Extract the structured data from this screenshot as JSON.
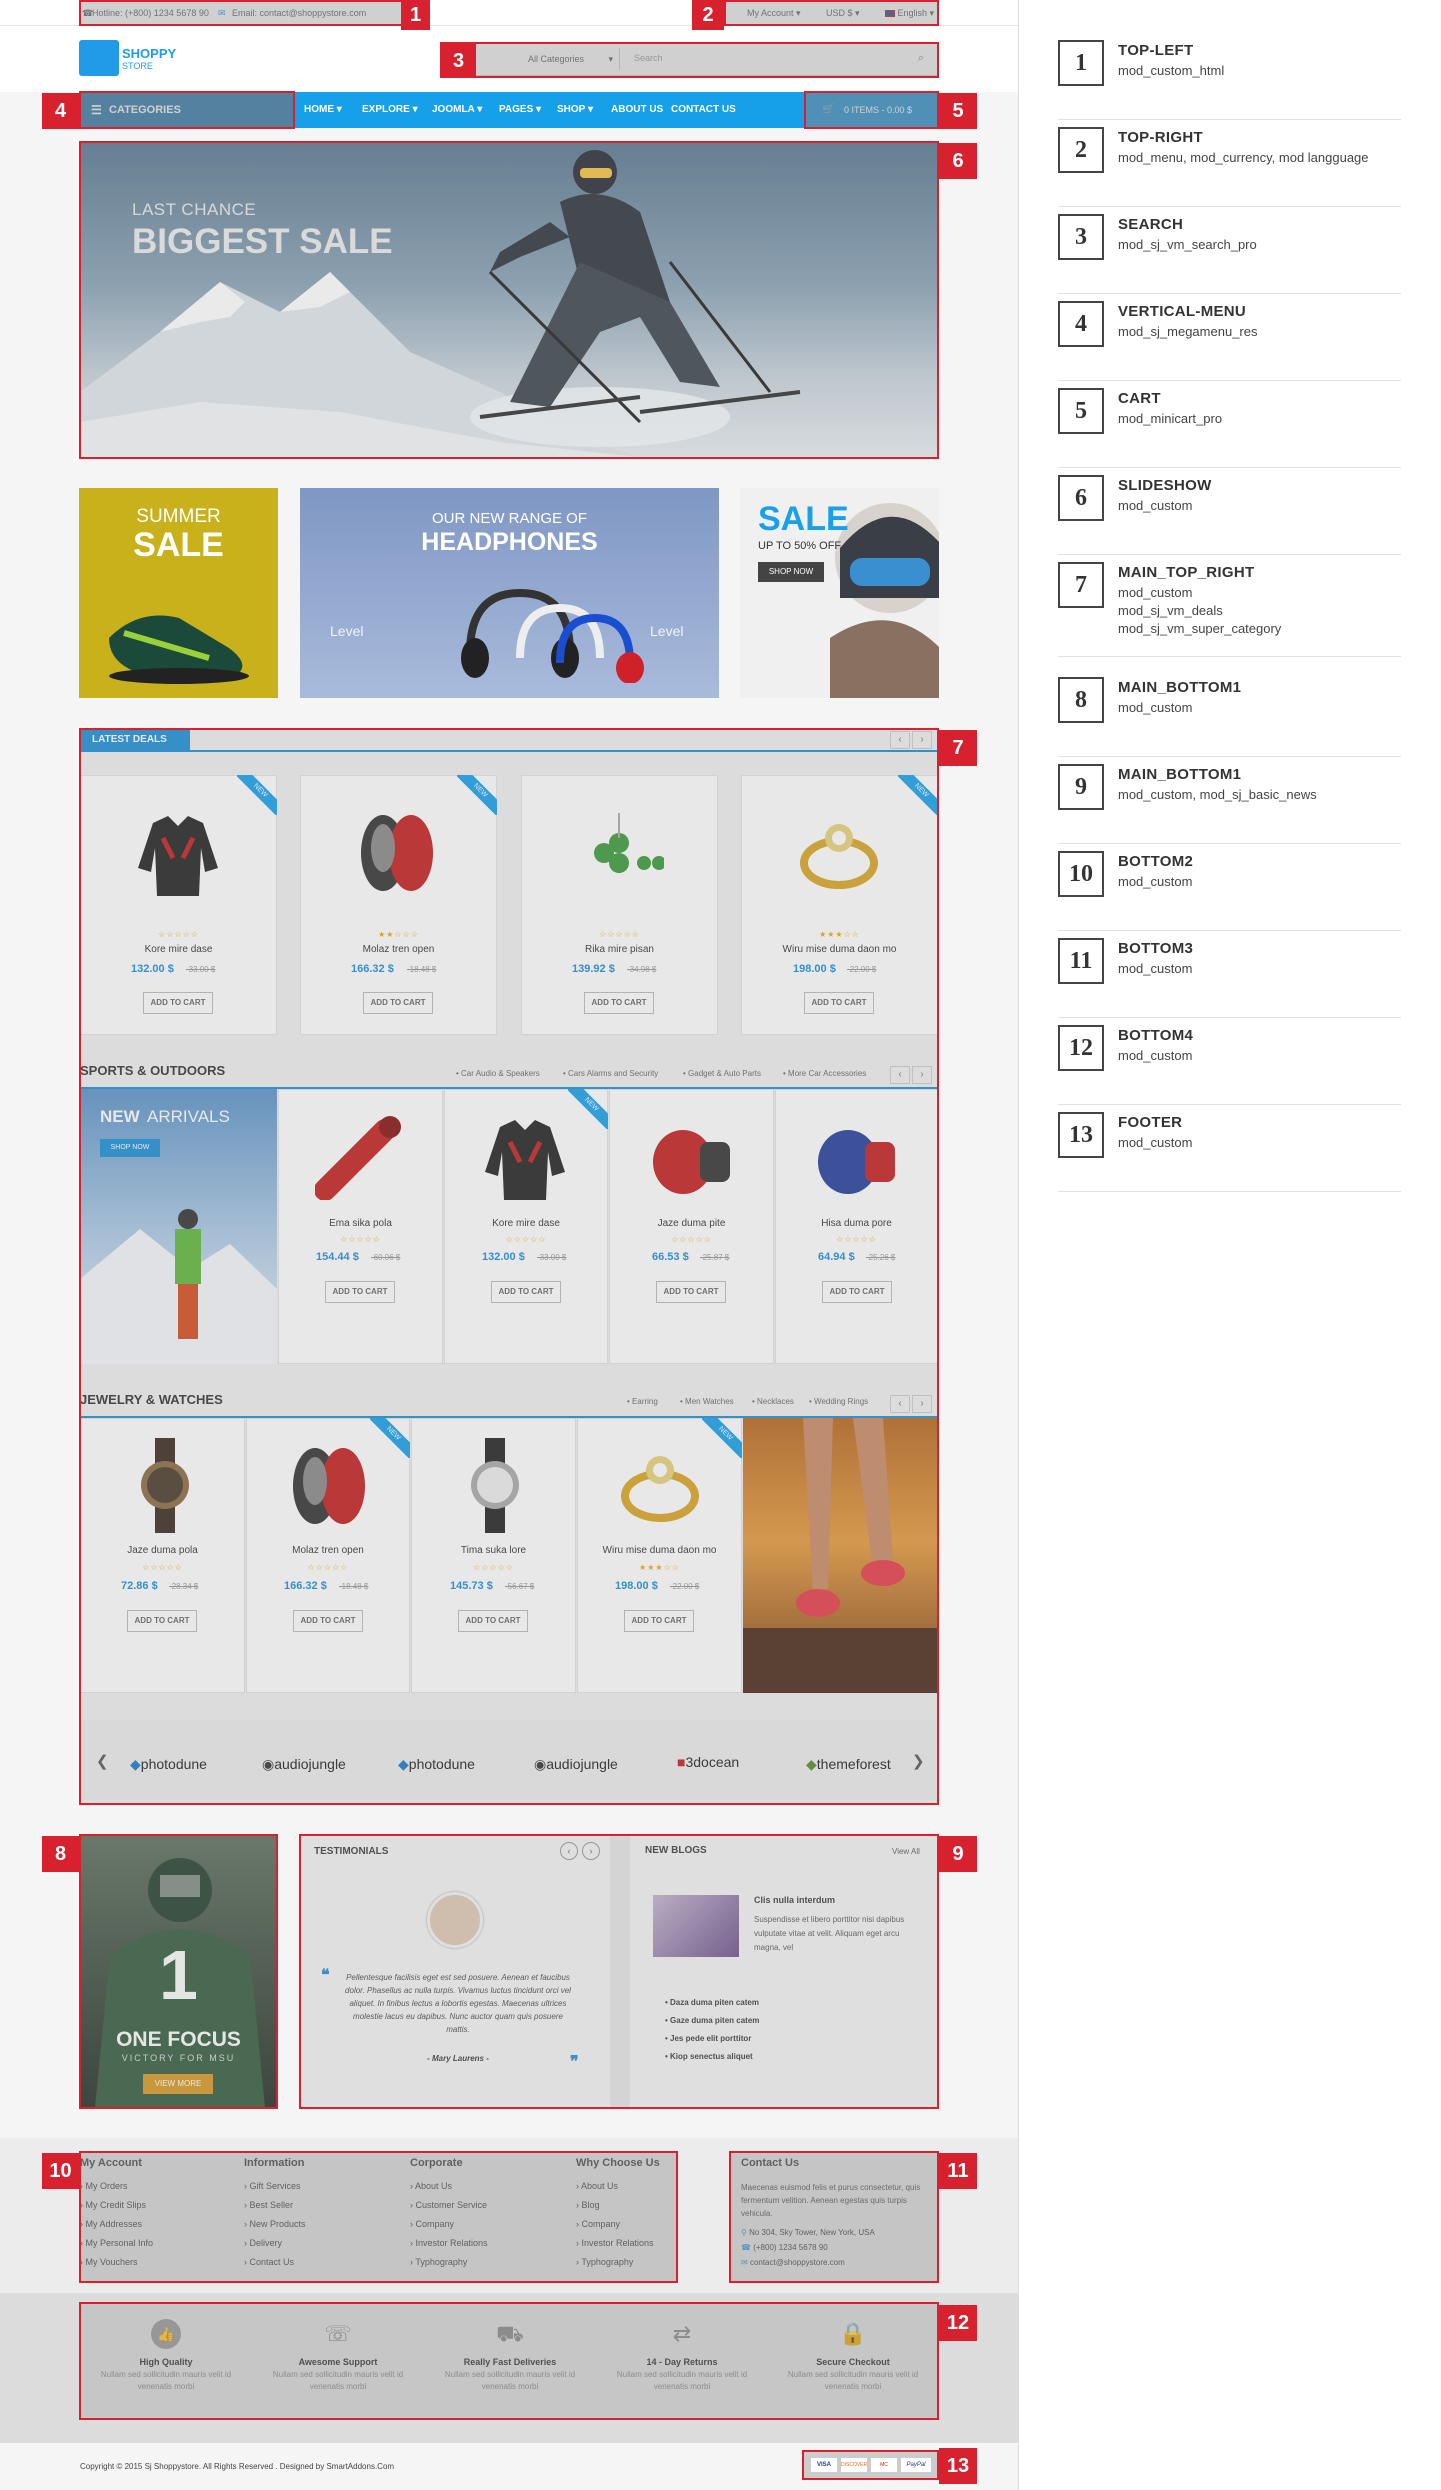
{
  "topbar": {
    "hotline": "Hotline: (+800) 1234 5678 90",
    "email": "Email: contact@shoppystore.com",
    "account": "My Account",
    "currency": "USD $",
    "language": "English"
  },
  "header": {
    "logo_line1": "SHOPPY",
    "logo_line2": "STORE",
    "search_category": "All Categories",
    "search_placeholder": "Search"
  },
  "nav": {
    "categories_label": "CATEGORIES",
    "items": [
      "HOME",
      "EXPLORE",
      "JOOMLA",
      "PAGES",
      "SHOP",
      "ABOUT US",
      "CONTACT US"
    ],
    "cart_label": "0 ITEMS - 0.00 $"
  },
  "slideshow": {
    "kicker": "LAST CHANCE",
    "headline": "BIGGEST SALE"
  },
  "banners": {
    "summer_1": "SUMMER",
    "summer_2": "SALE",
    "headphones_1": "OUR NEW RANGE OF",
    "headphones_2": "HEADPHONES",
    "headphones_brand": "Level",
    "sale_1": "SALE",
    "sale_2": "UP TO 50% OFF",
    "sale_btn": "SHOP NOW"
  },
  "latest_deals": {
    "title": "LATEST DEALS",
    "badge": "NEW",
    "button": "ADD TO CART",
    "products": [
      {
        "name": "Kore mire dase",
        "price": "132.00 $",
        "old": "-33.00 $",
        "stars": "☆☆☆☆☆"
      },
      {
        "name": "Molaz tren open",
        "price": "166.32 $",
        "old": "-18.48 $",
        "stars": "★★☆☆☆"
      },
      {
        "name": "Rika mire pisan",
        "price": "139.92 $",
        "old": "-34.98 $",
        "stars": "☆☆☆☆☆"
      },
      {
        "name": "Wiru mise duma daon mo",
        "price": "198.00 $",
        "old": "-22.00 $",
        "stars": "★★★☆☆"
      }
    ]
  },
  "sports": {
    "title": "SPORTS & OUTDOORS",
    "tabs": [
      "Car Audio & Speakers",
      "Cars Alarms and Security",
      "Gadget & Auto Parts",
      "More Car Accessories"
    ],
    "promo_1": "NEW",
    "promo_2": "ARRIVALS",
    "promo_btn": "SHOP NOW",
    "badge": "NEW",
    "button": "ADD TO CART",
    "products": [
      {
        "name": "Ema sika pola",
        "price": "154.44 $",
        "old": "-60.06 $",
        "stars": "☆☆☆☆☆"
      },
      {
        "name": "Kore mire dase",
        "price": "132.00 $",
        "old": "-33.00 $",
        "stars": "☆☆☆☆☆"
      },
      {
        "name": "Jaze duma pite",
        "price": "66.53 $",
        "old": "-25.87 $",
        "stars": "☆☆☆☆☆"
      },
      {
        "name": "Hisa duma pore",
        "price": "64.94 $",
        "old": "-25.26 $",
        "stars": "☆☆☆☆☆"
      }
    ]
  },
  "jewelry": {
    "title": "JEWELRY & WATCHES",
    "tabs": [
      "Earring",
      "Men Watches",
      "Necklaces",
      "Wedding Rings"
    ],
    "badge": "NEW",
    "button": "ADD TO CART",
    "products": [
      {
        "name": "Jaze duma pola",
        "price": "72.86 $",
        "old": "-28.34 $",
        "stars": "☆☆☆☆☆"
      },
      {
        "name": "Molaz tren open",
        "price": "166.32 $",
        "old": "-18.48 $",
        "stars": "☆☆☆☆☆"
      },
      {
        "name": "Tima suka lore",
        "price": "145.73 $",
        "old": "-56.67 $",
        "stars": "☆☆☆☆☆"
      },
      {
        "name": "Wiru mise duma daon mo",
        "price": "198.00 $",
        "old": "-22.00 $",
        "stars": "★★★☆☆"
      }
    ]
  },
  "brands": [
    "photodune",
    "audiojungle",
    "photodune",
    "audiojungle",
    "3docean",
    "themeforest"
  ],
  "msu": {
    "line1": "ONE FOCUS",
    "line2": "VICTORY FOR MSU",
    "button": "VIEW MORE",
    "jersey": "1"
  },
  "testimonials": {
    "title": "TESTIMONIALS",
    "quote": "Pellentesque facilisis eget est sed posuere. Aenean et faucibus dolor. Phasellus ac nulla turpis. Vivamus luctus tincidunt orci vel aliquet. In finibus lectus a lobortis egestas. Maecenas ultrices molestie lacus eu dapibus. Nunc auctor quam quis posuere mattis.",
    "author": "- Mary Laurens -"
  },
  "blogs": {
    "title": "NEW BLOGS",
    "view_all": "View All",
    "post_title": "Clis nulla interdum",
    "post_text": "Suspendisse et libero porttitor nisi dapibus vulputate vitae at velit. Aliquam eget arcu magna, vel",
    "list": [
      "Daza duma piten catem",
      "Gaze duma piten catem",
      "Jes pede elit porttitor",
      "Kiop senectus aliquet"
    ]
  },
  "footer_cols": [
    {
      "title": "My Account",
      "items": [
        "My Orders",
        "My Credit Slips",
        "My Addresses",
        "My Personal Info",
        "My Vouchers"
      ]
    },
    {
      "title": "Information",
      "items": [
        "Gift Services",
        "Best Seller",
        "New Products",
        "Delivery",
        "Contact Us"
      ]
    },
    {
      "title": "Corporate",
      "items": [
        "About Us",
        "Customer Service",
        "Company",
        "Investor Relations",
        "Typhography"
      ]
    },
    {
      "title": "Why Choose Us",
      "items": [
        "About Us",
        "Blog",
        "Company",
        "Investor Relations",
        "Typhography"
      ]
    }
  ],
  "contact": {
    "title": "Contact Us",
    "text": "Maecenas euismod felis et purus consectetur, quis fermentum velition. Aenean egestas quis turpis vehicula.",
    "address": "No 304, Sky Tower, New York, USA",
    "phone": "(+800) 1234 5678 90",
    "email": "contact@shoppystore.com"
  },
  "features": [
    {
      "title": "High Quality",
      "text": "Nullam sed sollicitudin mauris velit id venenatis morbi",
      "icon": "thumbs-up-icon"
    },
    {
      "title": "Awesome Support",
      "text": "Nullam sed sollicitudin mauris velit id venenatis morbi",
      "icon": "support-icon"
    },
    {
      "title": "Really Fast Deliveries",
      "text": "Nullam sed sollicitudin mauris velit id venenatis morbi",
      "icon": "truck-icon"
    },
    {
      "title": "14 - Day Returns",
      "text": "Nullam sed sollicitudin mauris velit id venenatis morbi",
      "icon": "return-arrows-icon"
    },
    {
      "title": "Secure Checkout",
      "text": "Nullam sed sollicitudin mauris velit id venenatis morbi",
      "icon": "lock-icon"
    }
  ],
  "copyright": "Copyright © 2015 Sj Shoppystore. All Rights Reserved . Designed by SmartAddons.Com",
  "payments": [
    "VISA",
    "DISCOVER",
    "MC",
    "PayPal"
  ],
  "markers": [
    "1",
    "2",
    "3",
    "4",
    "5",
    "6",
    "7",
    "8",
    "9",
    "10",
    "11",
    "12",
    "13"
  ],
  "legend": [
    {
      "num": "1",
      "title": "TOP-LEFT",
      "sub": "mod_custom_html"
    },
    {
      "num": "2",
      "title": "TOP-RIGHT",
      "sub": "mod_menu, mod_currency, mod langguage"
    },
    {
      "num": "3",
      "title": "SEARCH",
      "sub": "mod_sj_vm_search_pro"
    },
    {
      "num": "4",
      "title": "VERTICAL-MENU",
      "sub": "mod_sj_megamenu_res"
    },
    {
      "num": "5",
      "title": "CART",
      "sub": "mod_minicart_pro"
    },
    {
      "num": "6",
      "title": "SLIDESHOW",
      "sub": "mod_custom"
    },
    {
      "num": "7",
      "title": "MAIN_TOP_RIGHT",
      "sub": "mod_custom\nmod_sj_vm_deals\nmod_sj_vm_super_category"
    },
    {
      "num": "8",
      "title": "MAIN_BOTTOM1",
      "sub": "mod_custom"
    },
    {
      "num": "9",
      "title": "MAIN_BOTTOM1",
      "sub": "mod_custom, mod_sj_basic_news"
    },
    {
      "num": "10",
      "title": "BOTTOM2",
      "sub": "mod_custom"
    },
    {
      "num": "11",
      "title": "BOTTOM3",
      "sub": "mod_custom"
    },
    {
      "num": "12",
      "title": "BOTTOM4",
      "sub": "mod_custom"
    },
    {
      "num": "13",
      "title": "FOOTER",
      "sub": "mod_custom"
    }
  ]
}
